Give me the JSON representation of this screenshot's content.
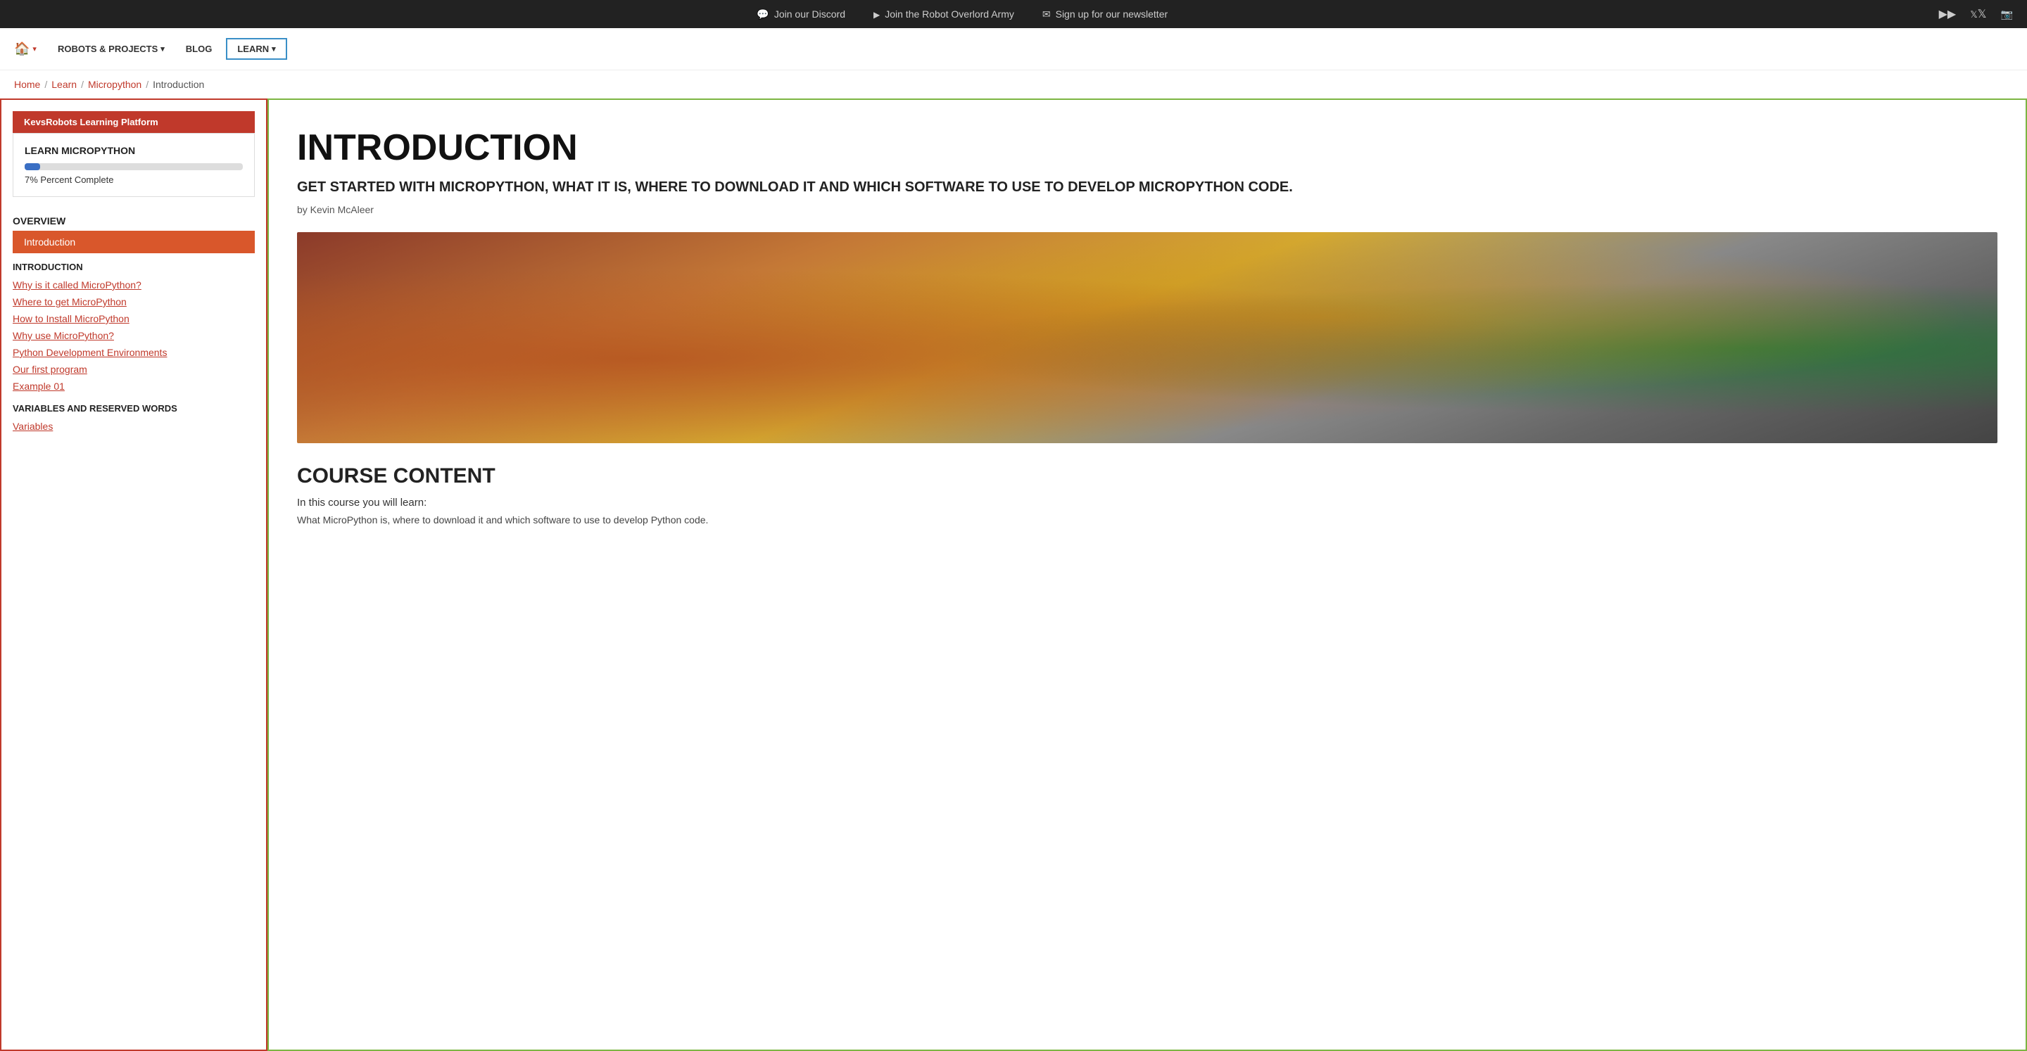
{
  "topbar": {
    "discord_label": "Join our Discord",
    "army_label": "Join the Robot Overlord Army",
    "newsletter_label": "Sign up for our newsletter",
    "youtube_icon": "youtube-icon",
    "twitter_icon": "twitter-icon",
    "instagram_icon": "instagram-icon"
  },
  "nav": {
    "home_label": "Home",
    "robots_label": "ROBOTS & PROJECTS",
    "blog_label": "BLOG",
    "learn_label": "LEARN"
  },
  "breadcrumb": {
    "home": "Home",
    "learn": "Learn",
    "micropython": "Micropython",
    "current": "Introduction"
  },
  "sidebar": {
    "platform_label": "KevsRobots Learning Platform",
    "course_title": "LEARN MICROPYTHON",
    "progress_percent": 7,
    "progress_text": "7% Percent Complete",
    "overview_label": "OVERVIEW",
    "active_item": "Introduction",
    "intro_section": "INTRODUCTION",
    "links": [
      "Why is it called MicroPython?",
      "Where to get MicroPython",
      "How to Install MicroPython",
      "Why use MicroPython?",
      "Python Development Environments",
      "Our first program",
      "Example 01"
    ],
    "variables_section": "VARIABLES AND RESERVED WORDS",
    "variables_links": [
      "Variables"
    ]
  },
  "main": {
    "title": "INTRODUCTION",
    "subtitle": "GET STARTED WITH MICROPYTHON, WHAT IT IS, WHERE TO DOWNLOAD IT AND WHICH SOFTWARE TO USE TO DEVELOP MICROPYTHON CODE.",
    "author": "by Kevin McAleer",
    "course_content_title": "COURSE CONTENT",
    "course_content_intro": "In this course you will learn:",
    "course_content_item": "What MicroPython is, where to download it and which software to use to develop Python code."
  }
}
